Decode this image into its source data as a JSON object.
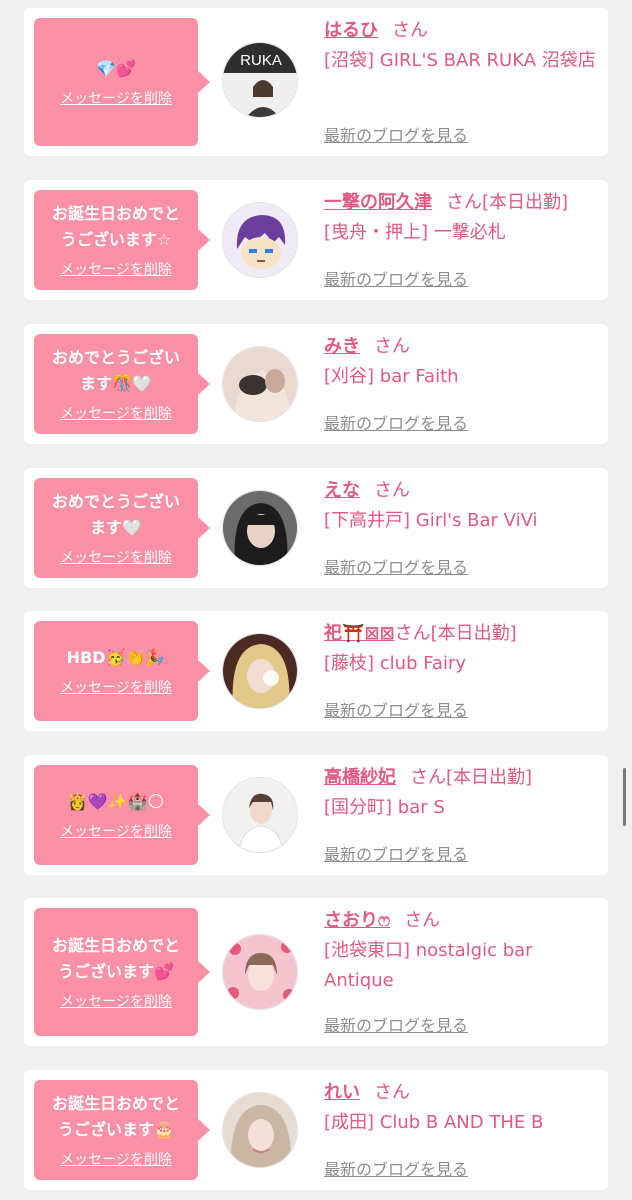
{
  "labels": {
    "delete": "メッセージを削除",
    "blog": "最新のブログを見る",
    "san": "さん"
  },
  "colors": {
    "accent": "#e05a82",
    "bubble": "#f990a6",
    "muted": "#8e8e8e"
  },
  "items": [
    {
      "message": "💎💕",
      "name": "はるひ",
      "suffix": "さん",
      "shop": "[沼袋] GIRL'S BAR RUKA 沼袋店",
      "avatar": "photo-ruka-sign"
    },
    {
      "message": "お誕生日おめでと\nうございます☆",
      "name": "一撃の阿久津",
      "suffix": "さん[本日出勤]",
      "shop": "[曳舟・押上] 一撃必札",
      "avatar": "cartoon-purple-hair"
    },
    {
      "message": "おめでとうござい\nます🎊🤍",
      "name": "みき",
      "suffix": "さん",
      "shop": "[刈谷] bar Faith",
      "avatar": "photo-woman-mask"
    },
    {
      "message": "おめでとうござい\nます🤍",
      "name": "えな",
      "suffix": "さん",
      "shop": "[下高井戸] Girl's Bar ViVi",
      "avatar": "photo-dark-hair"
    },
    {
      "message": "HBD🥳👏🎉",
      "name": "祀⛩️⊠⊠",
      "suffix": "さん[本日出勤]",
      "shop": "[藤枝] club Fairy",
      "avatar": "photo-blonde"
    },
    {
      "message": "👸💜✨🏰🌕",
      "name": "高橋紗妃",
      "suffix": "さん[本日出勤]",
      "shop": "[国分町] bar S",
      "avatar": "photo-white-outfit"
    },
    {
      "message": "お誕生日おめでと\nうございます💕",
      "name": "さおりෆ",
      "suffix": "さん",
      "shop": "[池袋東口] nostalgic bar Antique",
      "avatar": "photo-pink-flowers"
    },
    {
      "message": "お誕生日おめでと\nうございます🎂",
      "name": "れい",
      "suffix": "さん",
      "shop": "[成田] Club B AND THE B",
      "avatar": "photo-light-hair"
    }
  ]
}
